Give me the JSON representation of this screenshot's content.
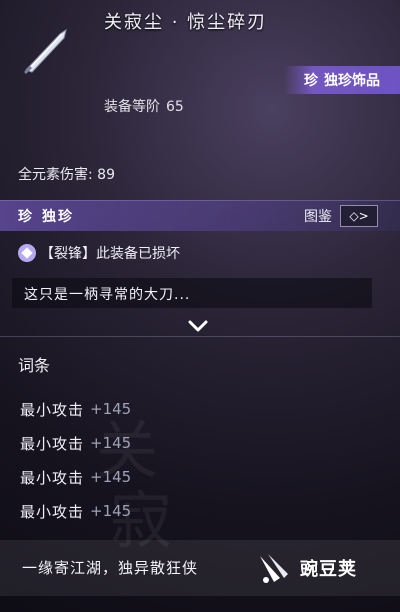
{
  "header": {
    "item_name": "关寂尘 · 惊尘碎刃",
    "rarity_tag_glyph": "珍",
    "rarity_tag_label": "独珍饰品",
    "equip_level_label": "装备等阶",
    "equip_level_value": "65"
  },
  "stats": {
    "element_damage": "全元素伤害: 89"
  },
  "rarity_bar": {
    "glyph": "珍",
    "name": "独珍",
    "codex_label": "图鉴",
    "codex_arrow": "◇>"
  },
  "status": {
    "text": "【裂锋】此装备已损坏"
  },
  "description": "这只是一柄寻常的大刀...",
  "affixes": {
    "title": "词条",
    "items": [
      {
        "name": "最小攻击",
        "value": "+145"
      },
      {
        "name": "最小攻击",
        "value": "+145"
      },
      {
        "name": "最小攻击",
        "value": "+145"
      },
      {
        "name": "最小攻击",
        "value": "+145"
      }
    ]
  },
  "footer": {
    "motto": "一缘寄江湖，独异散狂侠",
    "brand": "豌豆荚"
  },
  "colors": {
    "rarity_purple": "#6d54c4",
    "affix_value_gray": "#9ea3b8"
  },
  "icons": {
    "weapon": "blade-icon",
    "status": "diamond-badge-icon",
    "expand": "chevron-down-icon",
    "brand": "wandoujia-logo"
  }
}
